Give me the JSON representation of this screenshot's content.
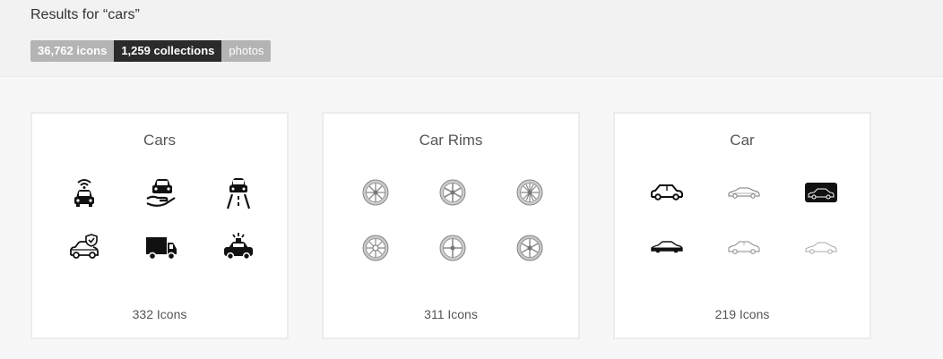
{
  "header": {
    "results_title": "Results for “cars”"
  },
  "tabs": [
    {
      "label": "36,762 icons",
      "active": false
    },
    {
      "label": "1,259 collections",
      "active": true
    },
    {
      "label": "photos",
      "active": false
    }
  ],
  "collections": [
    {
      "title": "Cars",
      "count": "332 Icons",
      "icons": [
        "connected-car-icon",
        "car-in-hand-icon",
        "car-on-road-icon",
        "car-insurance-shield-icon",
        "delivery-truck-icon",
        "police-car-icon"
      ]
    },
    {
      "title": "Car Rims",
      "count": "311 Icons",
      "icons": [
        "rim-icon",
        "rim-icon",
        "rim-icon",
        "rim-icon",
        "rim-icon",
        "rim-icon"
      ]
    },
    {
      "title": "Car",
      "count": "219 Icons",
      "icons": [
        "hatchback-outline-icon",
        "sedan-thin-icon",
        "car-badge-filled-icon",
        "sedan-solid-icon",
        "sedan-thin-icon",
        "coupe-thin-icon"
      ]
    }
  ],
  "colors": {
    "active_tab": "#2b2b2b",
    "inactive_tab": "#b4b4b4",
    "card_border": "#ececec"
  }
}
